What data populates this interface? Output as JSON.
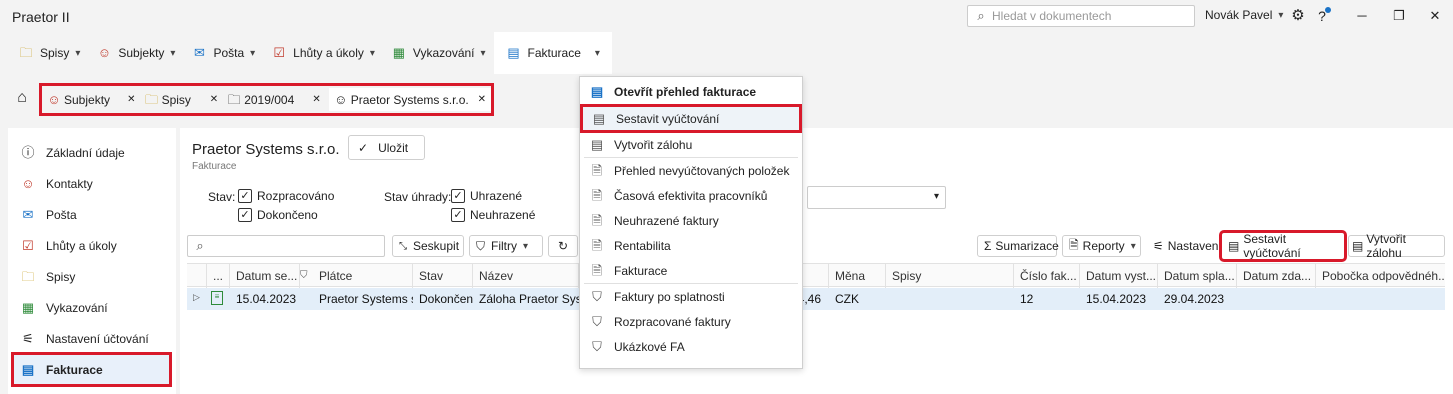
{
  "app_title": "Praetor II",
  "search_placeholder": "Hledat v dokumentech",
  "user_name": "Novák Pavel",
  "colors": {
    "accent": "#1b73c7",
    "highlight": "#d8192a",
    "row_selected": "#e3eef9"
  },
  "ribbon": [
    {
      "label": "Spisy",
      "icon": "folder-icon"
    },
    {
      "label": "Subjekty",
      "icon": "people-icon"
    },
    {
      "label": "Pošta",
      "icon": "mail-icon"
    },
    {
      "label": "Lhůty a úkoly",
      "icon": "calendar-check-icon"
    },
    {
      "label": "Vykazování",
      "icon": "timesheet-icon"
    },
    {
      "label": "Fakturace",
      "icon": "invoice-icon"
    }
  ],
  "breadcrumb_tabs": [
    "Subjekty",
    "Spisy",
    "2019/004",
    "Praetor Systems s.r.o."
  ],
  "sidebar": [
    "Základní údaje",
    "Kontakty",
    "Pošta",
    "Lhůty a úkoly",
    "Spisy",
    "Vykazování",
    "Nastavení účtování",
    "Fakturace"
  ],
  "header": {
    "title": "Praetor Systems s.r.o.",
    "subtitle": "Fakturace",
    "save_label": "Uložit"
  },
  "filters": {
    "stav_label": "Stav:",
    "stav_options": [
      "Rozpracováno",
      "Dokončeno"
    ],
    "uhrada_label": "Stav úhrady:",
    "uhrada_options": [
      "Uhrazené",
      "Neuhrazené"
    ]
  },
  "toolbar": {
    "seskupit": "Seskupit",
    "filtry": "Filtry",
    "sumarizace": "Sumarizace",
    "reporty": "Reporty",
    "nastaveni": "Nastavení",
    "sestavit": "Sestavit vyúčtování",
    "vytvorit": "Vytvořit zálohu"
  },
  "table": {
    "columns": [
      "...",
      "Datum se...",
      "Plátce",
      "Stav",
      "Název",
      "z",
      "Měna",
      "Spisy",
      "Číslo fak...",
      "Datum vyst...",
      "Datum spla...",
      "Datum zda...",
      "Pobočka odpovědnéh..."
    ],
    "rows": [
      [
        "15.04.2023",
        "Praetor Systems s.",
        "Dokončen",
        "Záloha Praetor Syste",
        "64,46",
        "CZK",
        "",
        "12",
        "15.04.2023",
        "29.04.2023",
        "",
        ""
      ]
    ]
  },
  "dropdown": {
    "items": [
      {
        "label": "Otevřít přehled fakturace",
        "icon": "invoice-icon",
        "bold": true
      },
      {
        "label": "Sestavit vyúčtování",
        "icon": "document-list-icon"
      },
      {
        "label": "Vytvořit zálohu",
        "icon": "document-list-icon"
      },
      {
        "label": "Přehled nevyúčtovaných položek",
        "icon": "report-icon"
      },
      {
        "label": "Časová efektivita pracovníků",
        "icon": "report-icon"
      },
      {
        "label": "Neuhrazené faktury",
        "icon": "report-icon"
      },
      {
        "label": "Rentabilita",
        "icon": "report-icon"
      },
      {
        "label": "Fakturace",
        "icon": "report-icon"
      },
      {
        "label": "Faktury po splatnosti",
        "icon": "filter-icon"
      },
      {
        "label": "Rozpracované faktury",
        "icon": "filter-icon"
      },
      {
        "label": "Ukázkové FA",
        "icon": "filter-icon"
      }
    ]
  }
}
